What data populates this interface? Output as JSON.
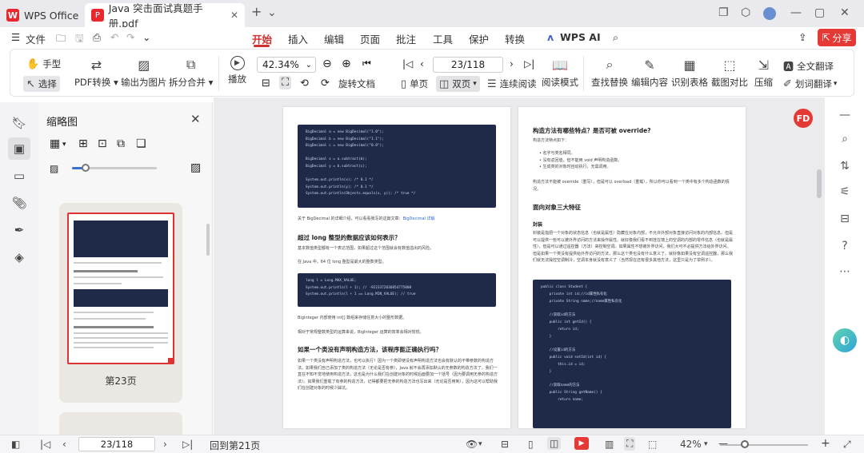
{
  "titlebar": {
    "home_tab": "WPS Office",
    "doc_tab": "Java 突击面试真题手册.pdf",
    "home_logo": "W",
    "pdf_logo": "P"
  },
  "menubar": {
    "file": "文件",
    "items": [
      "开始",
      "插入",
      "编辑",
      "页面",
      "批注",
      "工具",
      "保护",
      "转换"
    ],
    "ai": "WPS AI",
    "share": "分享"
  },
  "toolbar": {
    "hand": "手型",
    "select": "选择",
    "pdf_convert": "PDF转换",
    "to_image": "输出为图片",
    "split_merge": "拆分合并",
    "play": "播放",
    "zoom": "42.34%",
    "page_field": "23/118",
    "rotate": "旋转文档",
    "single": "单页",
    "double": "双页",
    "continuous": "连续阅读",
    "reading": "阅读模式",
    "find_replace": "查找替换",
    "edit_content": "编辑内容",
    "recognize_table": "识别表格",
    "screenshot_compare": "截图对比",
    "compress": "压缩",
    "full_translate": "全文翻译",
    "select_translate": "划词翻译"
  },
  "thumbpanel": {
    "title": "缩略图",
    "page_label": "第23页",
    "zoom_level": 0.12
  },
  "doc": {
    "left": {
      "code1": "BigDecimal a = new BigDecimal(\"1.0\");\nBigDecimal b = new BigDecimal(\"1.1\");\nBigDecimal c = new BigDecimal(\"0.8\");\n\nBigDecimal x = a.subtract(b);\nBigDecimal y = b.subtract(c);\n\nSystem.out.println(x); /* 0.1 */\nSystem.out.println(y); /* 0.1 */\nSystem.out.println(Objects.equals(x, y)); /* true */",
      "note1_pre": "关于 BigDecimal 的详细介绍，可以看看我写的这篇文章：",
      "note1_link": "BigDecimal 详解",
      "h1": "超过 long 整型的数据应该如何表示？",
      "p1": "基本数值类型都有一个表达范围，如果超过这个范围就会有数值溢出的风险。",
      "p2": "在 Java 中，64 位 long 整型是最大的整数类型。",
      "code2": "long l = Long.MAX_VALUE;\nSystem.out.println(l + 1); // -9223372036854775808\nSystem.out.println(l + 1 == Long.MIN_VALUE); // true",
      "p3": "BigInteger 内部使用 int[] 数组来存储任意大小的整形数据。",
      "p4": "相对于常规整数类型的运算来说，BigInteger 运算的效率会相对较低。",
      "h2": "如果一个类没有声明构造方法，该程序能正确执行吗？",
      "p5": "如果一个类没有声明构造方法，也可以执行！因为一个类即使没有声明构造方法也会有默认的不带参数的构造方法。如果我们自己添加了类的构造方法（无论是否有参），Java 就不会再添加默认的无参数的构造方法了，我们一直在不知不觉地使用构造方法，这也是为什么我们在创建对象的时候后面要加一个括号（因为要调用无参的构造方法）。如果我们重载了有参的构造方法，记得都要把无参的构造方法也写出来（无论是否用到），因为这可以帮助我们在创建对象的时候少踩坑。"
    },
    "right": {
      "h1": "构造方法有哪些特点？是否可被 override?",
      "p1": "构造方法特点如下：",
      "bullets": [
        "名字与类名相同。",
        "没有返回值，但不能用 void 声明构造函数。",
        "生成类的对象时自动执行，无需调用。"
      ],
      "p2": "构造方法不能被 override（重写），但是可以 overload（重载），所以你可以看到一个类中有多个构造函数的情况。",
      "h2": "面向对象三大特征",
      "h3": "封装",
      "p3": "封装是指把一个对象的状态信息（也就是属性）隐藏在对象内部，不允许外部对象直接访问对象的内部信息。但是可以提供一些可以被外界访问的方法来操作属性。就好像我们看不到挂在墙上的空调的内部的零件信息（也就是属性），但是可以通过遥控器（方法）来控制空调。如果属性不想被外界访问，我们大可不必提供方法给外界访问。但是如果一个类没有提供给外界访问的方法，那么这个类也没有什么意义了。就好像如果没有空调遥控器，那么我们就无法操控空调制冷，空调本身就没有意义了（当然现在还有很多其他方法，这里只是为了举例子）。",
      "code": "public class Student {\n    private int id;//id属性私有化\n    private String name;//name属性私有化\n\n    //获取id的方法\n    public int getId() {\n        return id;\n    }\n\n    //设置id的方法\n    public void setId(int id) {\n        this.id = id;\n    }\n\n    //获取name的方法\n    public String getName() {\n        return name;"
    }
  },
  "rightrail": {
    "badge": "FD"
  },
  "statusbar": {
    "page_field": "23/118",
    "status": "回到第21页",
    "zoom": "42%",
    "zoom_level": 0.42
  },
  "colors": {
    "accent": "#d32f2f",
    "share": "#e53935",
    "code_bg": "#1e2a47"
  }
}
